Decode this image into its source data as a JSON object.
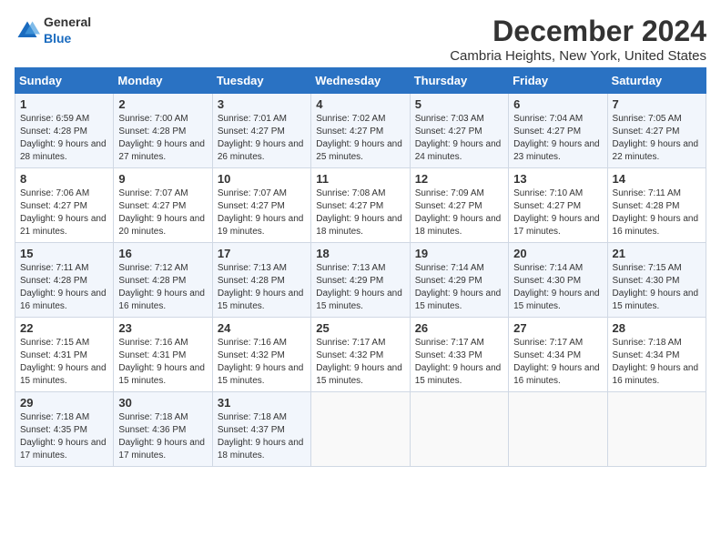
{
  "logo": {
    "general": "General",
    "blue": "Blue"
  },
  "title": "December 2024",
  "subtitle": "Cambria Heights, New York, United States",
  "days_of_week": [
    "Sunday",
    "Monday",
    "Tuesday",
    "Wednesday",
    "Thursday",
    "Friday",
    "Saturday"
  ],
  "weeks": [
    [
      {
        "day": "1",
        "sunrise": "6:59 AM",
        "sunset": "4:28 PM",
        "daylight": "9 hours and 28 minutes."
      },
      {
        "day": "2",
        "sunrise": "7:00 AM",
        "sunset": "4:28 PM",
        "daylight": "9 hours and 27 minutes."
      },
      {
        "day": "3",
        "sunrise": "7:01 AM",
        "sunset": "4:27 PM",
        "daylight": "9 hours and 26 minutes."
      },
      {
        "day": "4",
        "sunrise": "7:02 AM",
        "sunset": "4:27 PM",
        "daylight": "9 hours and 25 minutes."
      },
      {
        "day": "5",
        "sunrise": "7:03 AM",
        "sunset": "4:27 PM",
        "daylight": "9 hours and 24 minutes."
      },
      {
        "day": "6",
        "sunrise": "7:04 AM",
        "sunset": "4:27 PM",
        "daylight": "9 hours and 23 minutes."
      },
      {
        "day": "7",
        "sunrise": "7:05 AM",
        "sunset": "4:27 PM",
        "daylight": "9 hours and 22 minutes."
      }
    ],
    [
      {
        "day": "8",
        "sunrise": "7:06 AM",
        "sunset": "4:27 PM",
        "daylight": "9 hours and 21 minutes."
      },
      {
        "day": "9",
        "sunrise": "7:07 AM",
        "sunset": "4:27 PM",
        "daylight": "9 hours and 20 minutes."
      },
      {
        "day": "10",
        "sunrise": "7:07 AM",
        "sunset": "4:27 PM",
        "daylight": "9 hours and 19 minutes."
      },
      {
        "day": "11",
        "sunrise": "7:08 AM",
        "sunset": "4:27 PM",
        "daylight": "9 hours and 18 minutes."
      },
      {
        "day": "12",
        "sunrise": "7:09 AM",
        "sunset": "4:27 PM",
        "daylight": "9 hours and 18 minutes."
      },
      {
        "day": "13",
        "sunrise": "7:10 AM",
        "sunset": "4:27 PM",
        "daylight": "9 hours and 17 minutes."
      },
      {
        "day": "14",
        "sunrise": "7:11 AM",
        "sunset": "4:28 PM",
        "daylight": "9 hours and 16 minutes."
      }
    ],
    [
      {
        "day": "15",
        "sunrise": "7:11 AM",
        "sunset": "4:28 PM",
        "daylight": "9 hours and 16 minutes."
      },
      {
        "day": "16",
        "sunrise": "7:12 AM",
        "sunset": "4:28 PM",
        "daylight": "9 hours and 16 minutes."
      },
      {
        "day": "17",
        "sunrise": "7:13 AM",
        "sunset": "4:28 PM",
        "daylight": "9 hours and 15 minutes."
      },
      {
        "day": "18",
        "sunrise": "7:13 AM",
        "sunset": "4:29 PM",
        "daylight": "9 hours and 15 minutes."
      },
      {
        "day": "19",
        "sunrise": "7:14 AM",
        "sunset": "4:29 PM",
        "daylight": "9 hours and 15 minutes."
      },
      {
        "day": "20",
        "sunrise": "7:14 AM",
        "sunset": "4:30 PM",
        "daylight": "9 hours and 15 minutes."
      },
      {
        "day": "21",
        "sunrise": "7:15 AM",
        "sunset": "4:30 PM",
        "daylight": "9 hours and 15 minutes."
      }
    ],
    [
      {
        "day": "22",
        "sunrise": "7:15 AM",
        "sunset": "4:31 PM",
        "daylight": "9 hours and 15 minutes."
      },
      {
        "day": "23",
        "sunrise": "7:16 AM",
        "sunset": "4:31 PM",
        "daylight": "9 hours and 15 minutes."
      },
      {
        "day": "24",
        "sunrise": "7:16 AM",
        "sunset": "4:32 PM",
        "daylight": "9 hours and 15 minutes."
      },
      {
        "day": "25",
        "sunrise": "7:17 AM",
        "sunset": "4:32 PM",
        "daylight": "9 hours and 15 minutes."
      },
      {
        "day": "26",
        "sunrise": "7:17 AM",
        "sunset": "4:33 PM",
        "daylight": "9 hours and 15 minutes."
      },
      {
        "day": "27",
        "sunrise": "7:17 AM",
        "sunset": "4:34 PM",
        "daylight": "9 hours and 16 minutes."
      },
      {
        "day": "28",
        "sunrise": "7:18 AM",
        "sunset": "4:34 PM",
        "daylight": "9 hours and 16 minutes."
      }
    ],
    [
      {
        "day": "29",
        "sunrise": "7:18 AM",
        "sunset": "4:35 PM",
        "daylight": "9 hours and 17 minutes."
      },
      {
        "day": "30",
        "sunrise": "7:18 AM",
        "sunset": "4:36 PM",
        "daylight": "9 hours and 17 minutes."
      },
      {
        "day": "31",
        "sunrise": "7:18 AM",
        "sunset": "4:37 PM",
        "daylight": "9 hours and 18 minutes."
      },
      null,
      null,
      null,
      null
    ]
  ]
}
